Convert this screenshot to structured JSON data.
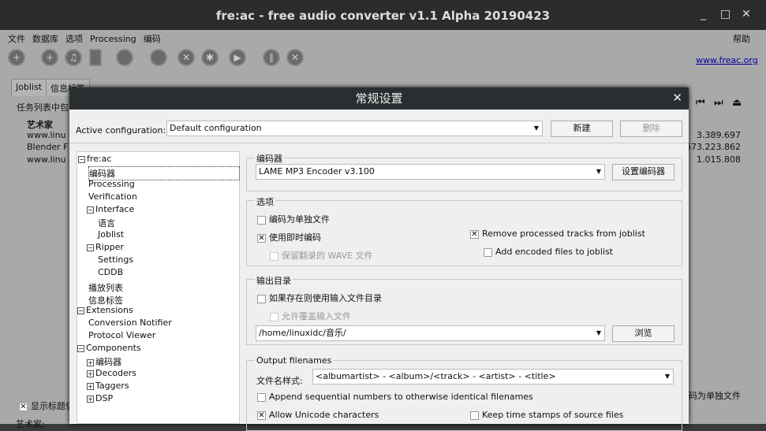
{
  "window": {
    "title": "fre:ac - free audio converter v1.1 Alpha 20190423",
    "min": "_",
    "max": "□",
    "close": "✕"
  },
  "menu": [
    "文件",
    "数据库",
    "选项",
    "Processing",
    "编码"
  ],
  "help": "帮助",
  "link": "www.freac.org",
  "tabs": [
    "Joblist",
    "信息标签"
  ],
  "joblist": {
    "caption": "任务列表中包",
    "header": "艺术家",
    "rows": [
      {
        "artist": "www.linu",
        "size": "3.389.697"
      },
      {
        "artist": "Blender F",
        "size": "673.223.862"
      },
      {
        "artist": "www.linu",
        "size": "1.015.808"
      }
    ]
  },
  "bottom": {
    "show_title": "显示标题信",
    "artist_label": "艺术家:",
    "encode_single": "码为单独文件"
  },
  "dialog": {
    "title": "常规设置",
    "active_config_label": "Active configuration:",
    "active_config": "Default configuration",
    "new": "新建",
    "delete": "删除",
    "tree": [
      {
        "label": "fre:ac",
        "tog": "−"
      },
      {
        "label": "编码器"
      },
      {
        "label": "Processing"
      },
      {
        "label": "Verification"
      },
      {
        "label": "Interface",
        "tog": "−"
      },
      {
        "label": "语言"
      },
      {
        "label": "Joblist"
      },
      {
        "label": "Ripper",
        "tog": "−"
      },
      {
        "label": "Settings"
      },
      {
        "label": "CDDB"
      },
      {
        "label": "播放列表"
      },
      {
        "label": "信息标签"
      },
      {
        "label": "Extensions",
        "tog": "−"
      },
      {
        "label": "Conversion Notifier"
      },
      {
        "label": "Protocol Viewer"
      },
      {
        "label": "Components",
        "tog": "−"
      },
      {
        "label": "编码器",
        "tog": "+"
      },
      {
        "label": "Decoders",
        "tog": "+"
      },
      {
        "label": "Taggers",
        "tog": "+"
      },
      {
        "label": "DSP",
        "tog": "+"
      }
    ],
    "encoder_group": "编码器",
    "encoder": "LAME MP3 Encoder v3.100",
    "config_encoder": "设置编码器",
    "options_group": "选项",
    "opt_single": "编码为单独文件",
    "opt_onthefly": "使用即时编码",
    "opt_keep_wave": "保留翻录的 WAVE 文件",
    "opt_remove": "Remove processed tracks from joblist",
    "opt_add": "Add encoded files to joblist",
    "output_group": "输出目录",
    "out_use_input": "如果存在则使用输入文件目录",
    "out_overwrite": "允许覆盖输入文件",
    "out_dir": "/home/linuxidc/音乐/",
    "browse": "浏览",
    "fn_group": "Output filenames",
    "fn_label": "文件名样式:",
    "fn_pattern": "<albumartist> - <album>/<track> - <artist> - <title>",
    "fn_append": "Append sequential numbers to otherwise identical filenames",
    "fn_unicode": "Allow Unicode characters",
    "fn_timestamps": "Keep time stamps of source files"
  }
}
